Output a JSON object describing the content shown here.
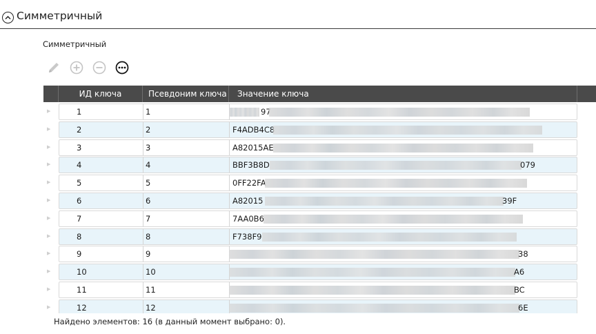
{
  "section": {
    "title": "Симметричный"
  },
  "group_label": "Симметричный",
  "toolbar": {
    "edit_icon": "pencil-icon",
    "add_icon": "plus-circle-icon",
    "remove_icon": "minus-circle-icon",
    "more_icon": "more-circle-icon"
  },
  "table": {
    "columns": [
      "ИД ключа",
      "Псевдоним ключа",
      "Значение ключа"
    ],
    "rows": [
      {
        "id": "1",
        "alias": "1",
        "prefix": "",
        "suffix": "",
        "prefix_visible": "97"
      },
      {
        "id": "2",
        "alias": "2",
        "prefix": "F4ADB4C8",
        "suffix": ""
      },
      {
        "id": "3",
        "alias": "3",
        "prefix": "A82015AE",
        "suffix": ""
      },
      {
        "id": "4",
        "alias": "4",
        "prefix": "BBF3B8D",
        "suffix": "079"
      },
      {
        "id": "5",
        "alias": "5",
        "prefix": "0FF22FA",
        "suffix": ""
      },
      {
        "id": "6",
        "alias": "6",
        "prefix": "A82015",
        "suffix": "39F"
      },
      {
        "id": "7",
        "alias": "7",
        "prefix": "7AA0B6",
        "suffix": ""
      },
      {
        "id": "8",
        "alias": "8",
        "prefix": "F738F9",
        "suffix": ""
      },
      {
        "id": "9",
        "alias": "9",
        "prefix": "",
        "suffix": "38"
      },
      {
        "id": "10",
        "alias": "10",
        "prefix": "",
        "suffix": "A6"
      },
      {
        "id": "11",
        "alias": "11",
        "prefix": "",
        "suffix": "BC"
      },
      {
        "id": "12",
        "alias": "12",
        "prefix": "",
        "suffix": "6E"
      }
    ]
  },
  "status": {
    "text": "Найдено элементов: 16 (в данный момент выбрано: 0)."
  },
  "colors": {
    "header_bg": "#4a4a4a",
    "row_alt": "#e8f4fa"
  }
}
